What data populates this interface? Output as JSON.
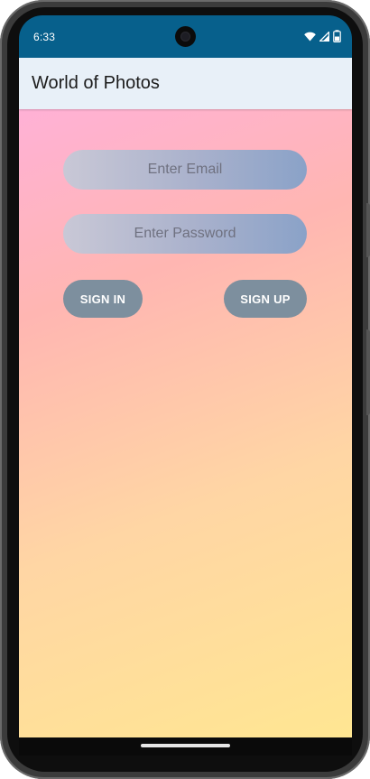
{
  "status_bar": {
    "time": "6:33",
    "icons": [
      "wifi-icon",
      "cellular-signal-icon",
      "battery-icon"
    ]
  },
  "app_bar": {
    "title": "World of Photos"
  },
  "form": {
    "email_placeholder": "Enter Email",
    "email_value": "",
    "password_placeholder": "Enter Password",
    "password_value": "",
    "sign_in_label": "SIGN IN",
    "sign_up_label": "SIGN UP"
  },
  "colors": {
    "status_bar": "#07608c",
    "app_bar": "#e8f0f8",
    "button": "#7d8f9e",
    "gradient_top": "#ffb1d6",
    "gradient_bottom": "#ffe692"
  }
}
